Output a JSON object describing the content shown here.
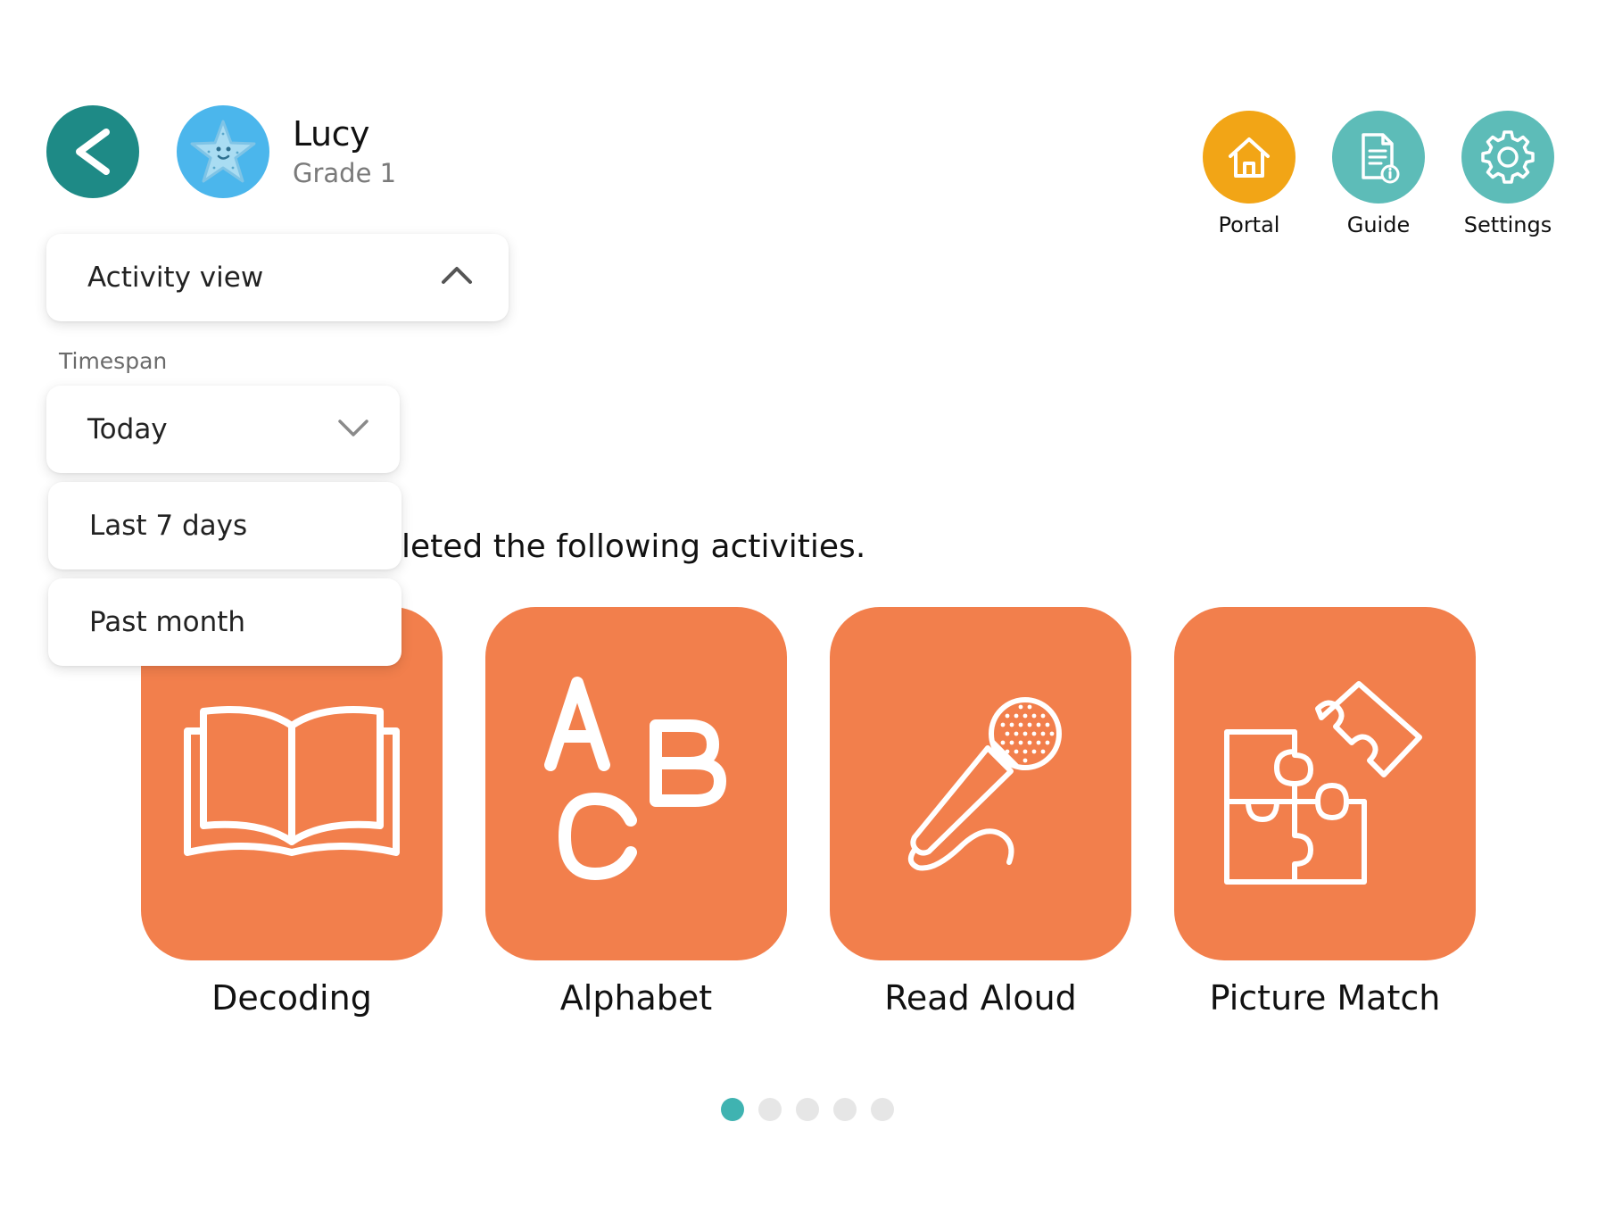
{
  "user": {
    "name": "Lucy",
    "grade": "Grade 1",
    "avatar_icon": "starfish-icon"
  },
  "nav": [
    {
      "label": "Portal",
      "icon": "home-icon",
      "color": "#f2a516"
    },
    {
      "label": "Guide",
      "icon": "document-info-icon",
      "color": "#5dbcb8"
    },
    {
      "label": "Settings",
      "icon": "gear-icon",
      "color": "#5dbcb8"
    }
  ],
  "view_select": {
    "label": "Activity view",
    "state": "expanded"
  },
  "timespan": {
    "label": "Timespan",
    "selected": "Today",
    "options": [
      "Last 7 days",
      "Past month"
    ]
  },
  "headline": "leted the following activities.",
  "activities": [
    {
      "label": "Decoding",
      "icon": "book-icon"
    },
    {
      "label": "Alphabet",
      "icon": "abc-icon"
    },
    {
      "label": "Read Aloud",
      "icon": "microphone-icon"
    },
    {
      "label": "Picture Match",
      "icon": "puzzle-icon"
    }
  ],
  "pagination": {
    "pages": 5,
    "current": 1
  },
  "colors": {
    "back_button": "#1e8a86",
    "avatar_bg": "#4bb6ec",
    "tile": "#f27f4c",
    "dot_active": "#3fb3b1",
    "dot_inactive": "#e6e6e6"
  }
}
